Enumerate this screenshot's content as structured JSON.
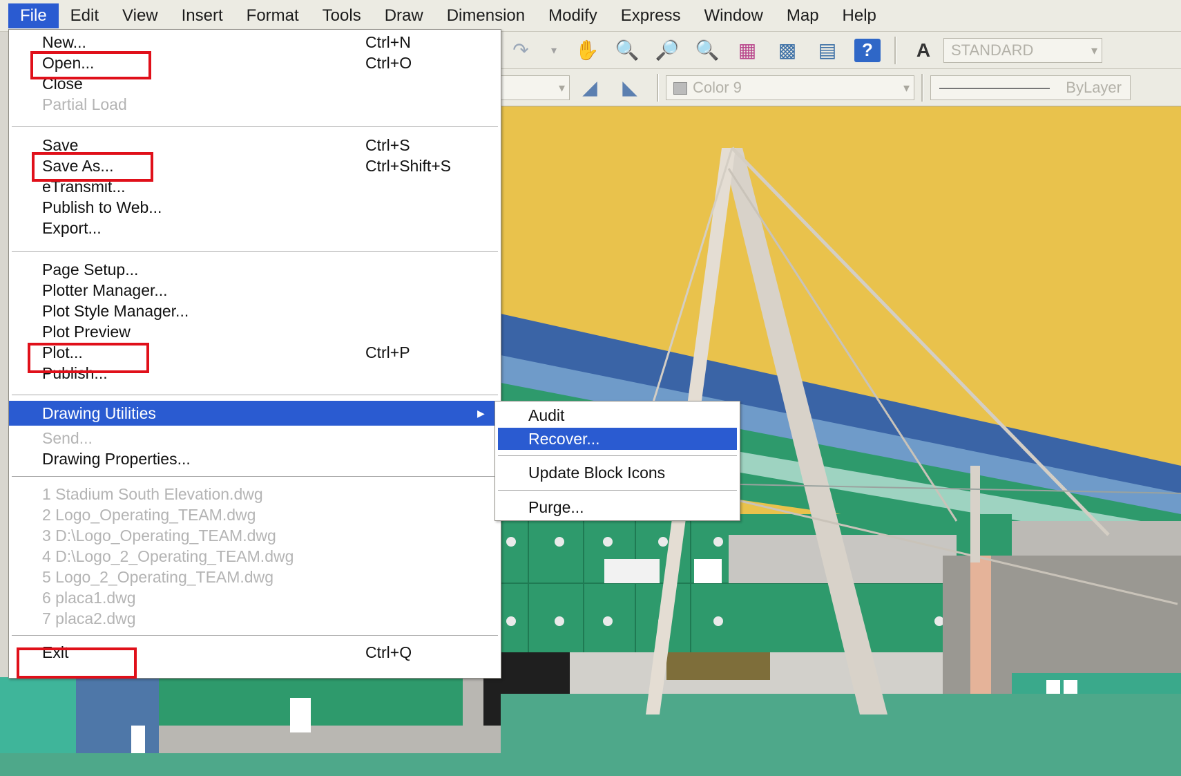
{
  "menubar": {
    "items": [
      "File",
      "Edit",
      "View",
      "Insert",
      "Format",
      "Tools",
      "Draw",
      "Dimension",
      "Modify",
      "Express",
      "Window",
      "Map",
      "Help"
    ]
  },
  "toolbar": {
    "text_style": "STANDARD",
    "color": "Color 9",
    "linetype": "ByLayer"
  },
  "file_menu": {
    "new": {
      "label": "New...",
      "shortcut": "Ctrl+N"
    },
    "open": {
      "label": "Open...",
      "shortcut": "Ctrl+O"
    },
    "close": {
      "label": "Close"
    },
    "partial_load": {
      "label": "Partial Load"
    },
    "save": {
      "label": "Save",
      "shortcut": "Ctrl+S"
    },
    "save_as": {
      "label": "Save As...",
      "shortcut": "Ctrl+Shift+S"
    },
    "etransmit": {
      "label": "eTransmit..."
    },
    "publish_web": {
      "label": "Publish to Web..."
    },
    "export": {
      "label": "Export..."
    },
    "page_setup": {
      "label": "Page Setup..."
    },
    "plotter_manager": {
      "label": "Plotter Manager..."
    },
    "plot_style_manager": {
      "label": "Plot Style Manager..."
    },
    "plot_preview": {
      "label": "Plot Preview"
    },
    "plot": {
      "label": "Plot...",
      "shortcut": "Ctrl+P"
    },
    "publish": {
      "label": "Publish..."
    },
    "drawing_utilities": {
      "label": "Drawing Utilities"
    },
    "send": {
      "label": "Send..."
    },
    "drawing_properties": {
      "label": "Drawing Properties..."
    },
    "recent_files": [
      "1 Stadium South Elevation.dwg",
      "2 Logo_Operating_TEAM.dwg",
      "3 D:\\Logo_Operating_TEAM.dwg",
      "4 D:\\Logo_2_Operating_TEAM.dwg",
      "5 Logo_2_Operating_TEAM.dwg",
      "6 placa1.dwg",
      "7 placa2.dwg"
    ],
    "exit": {
      "label": "Exit",
      "shortcut": "Ctrl+Q"
    }
  },
  "submenu": {
    "audit": "Audit",
    "recover": "Recover...",
    "update_block_icons": "Update Block Icons",
    "purge": "Purge..."
  },
  "colors": {
    "highlight": "#2a5bd1",
    "annotation_red": "#e0101a",
    "sky": "#e9c24c",
    "stadium_green": "#2e9a6c"
  }
}
